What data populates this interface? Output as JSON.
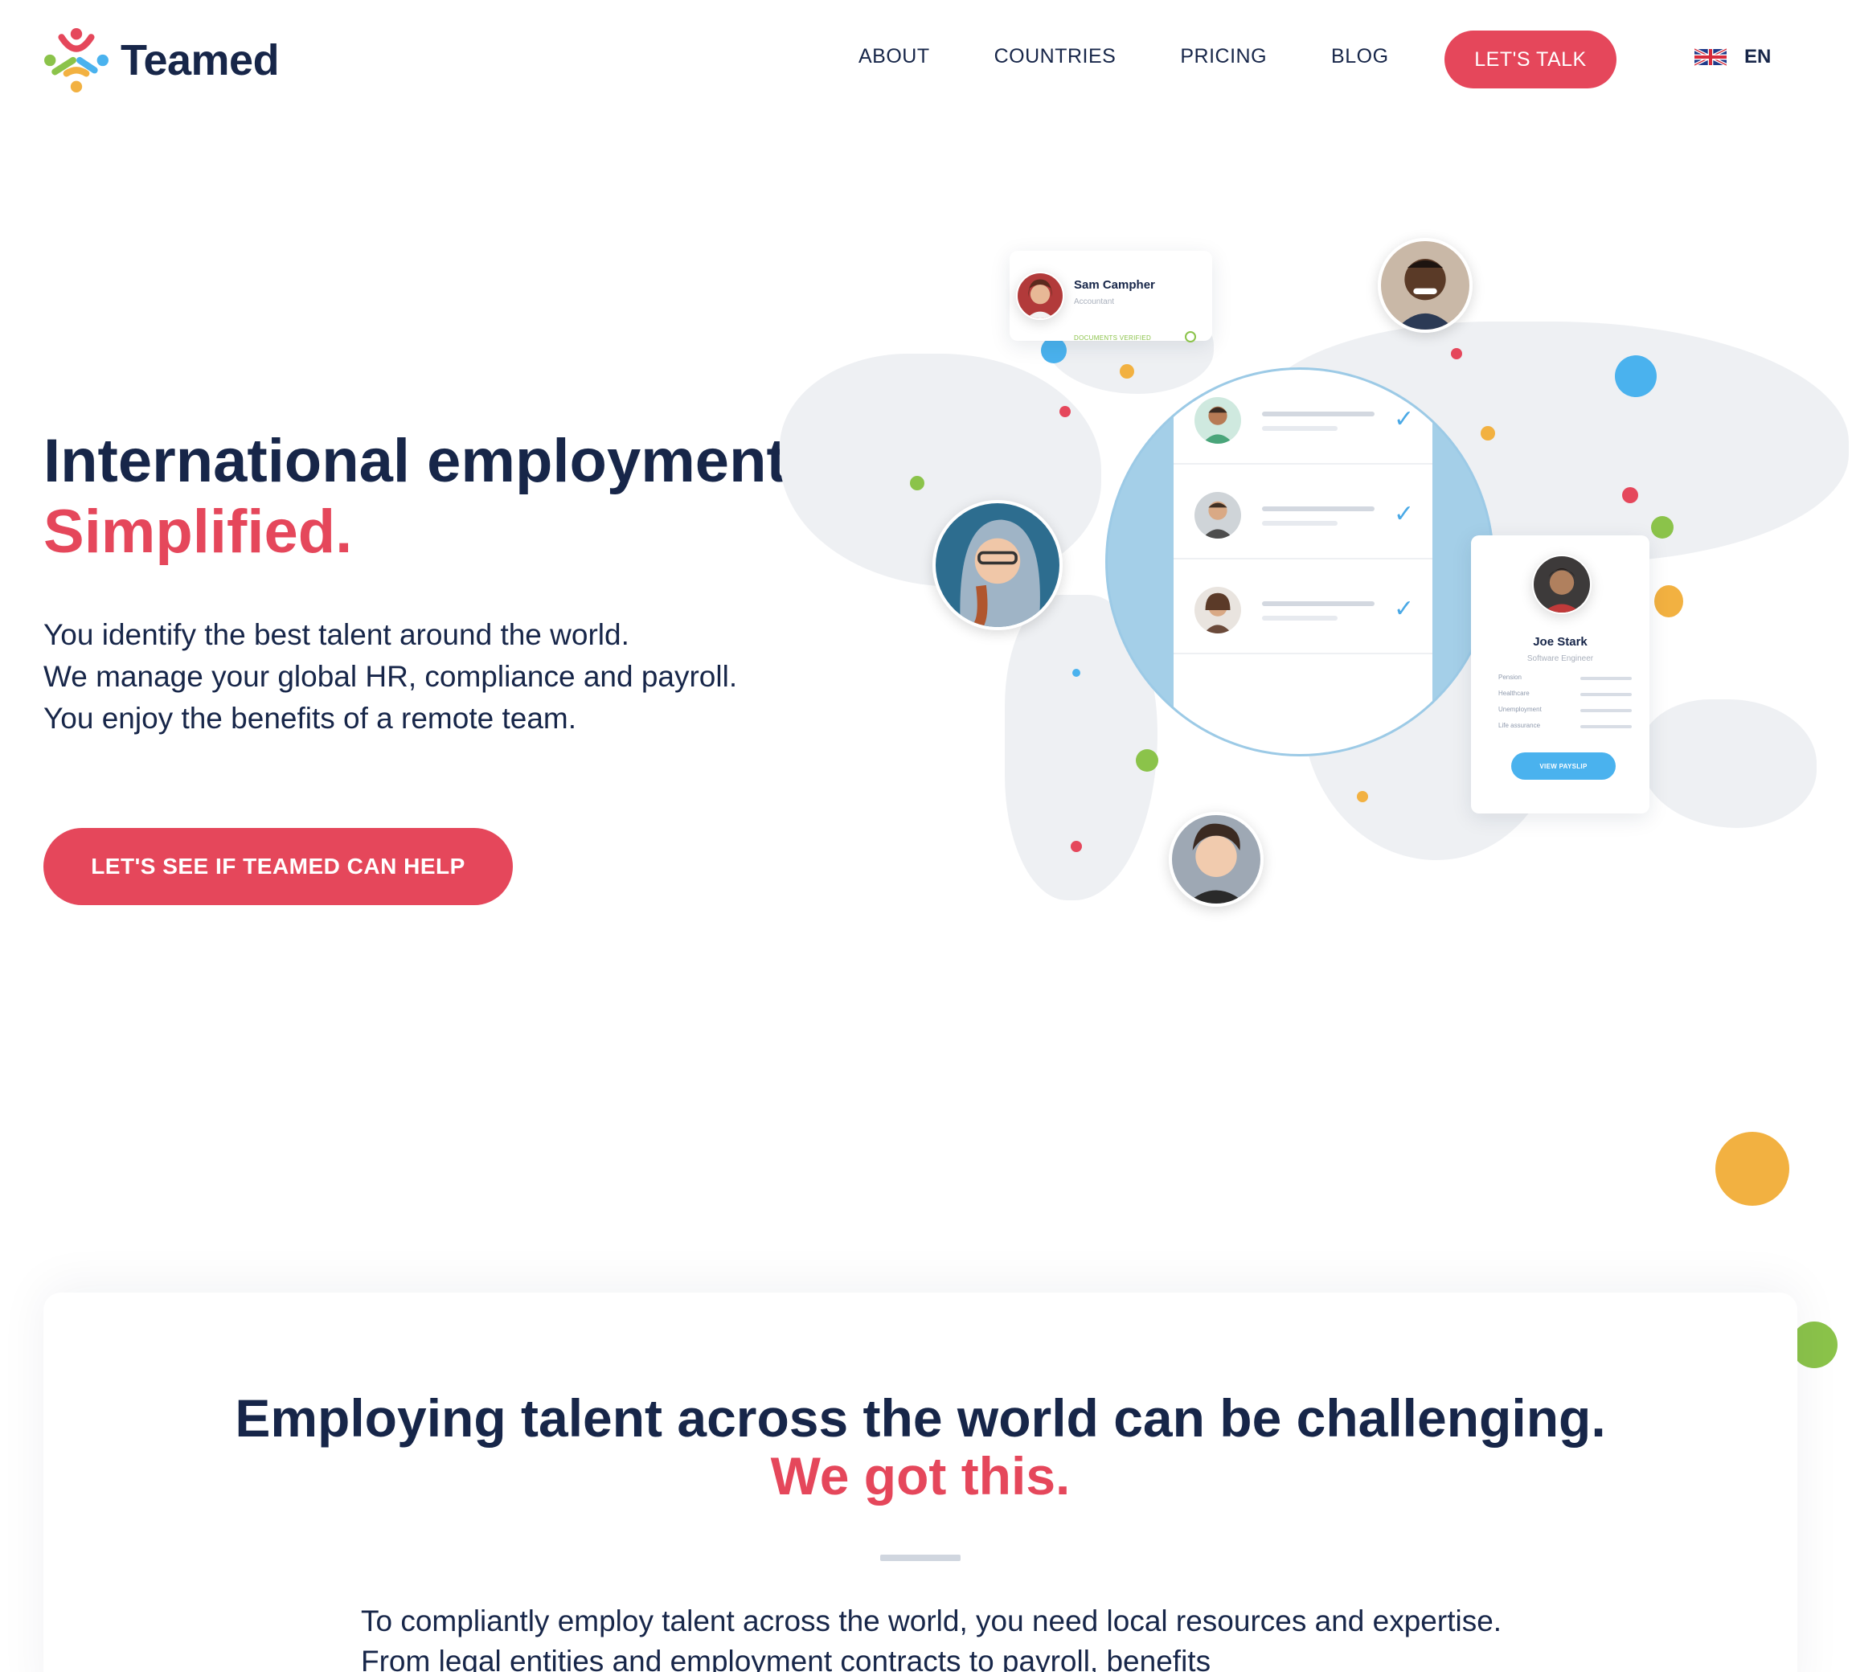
{
  "brand": {
    "name": "Teamed"
  },
  "nav": {
    "items": [
      "ABOUT",
      "COUNTRIES",
      "PRICING",
      "BLOG"
    ],
    "cta_label": "LET'S TALK"
  },
  "language": {
    "code": "EN",
    "flag_icon": "uk-flag-icon"
  },
  "hero": {
    "title_line1": "International employment",
    "title_line2": "Simplified.",
    "subtitle": [
      "You identify the best talent around the world.",
      "We manage your global HR, compliance and payroll.",
      "You enjoy the benefits of a remote team."
    ],
    "cta_label": "LET'S SEE IF TEAMED CAN HELP"
  },
  "illustration": {
    "sam_card": {
      "name": "Sam Campher",
      "role": "Accountant",
      "status": "DOCUMENTS VERIFIED"
    },
    "joe_card": {
      "name": "Joe Stark",
      "role": "Software Engineer",
      "rows": [
        "Pension",
        "Healthcare",
        "Unemployment",
        "Life assurance"
      ],
      "button_label": "VIEW PAYSLIP"
    },
    "check_glyph": "✓"
  },
  "section2": {
    "title_line1": "Employing talent across the world can be challenging.",
    "title_line2": "We got this.",
    "body": "To compliantly employ talent across the world, you need local resources and expertise. From legal entities and employment contracts to payroll, benefits"
  },
  "colors": {
    "navy": "#172649",
    "accent": "#e5475b",
    "blue": "#4ab2ee",
    "green": "#8bc34a",
    "orange": "#f2b141"
  }
}
